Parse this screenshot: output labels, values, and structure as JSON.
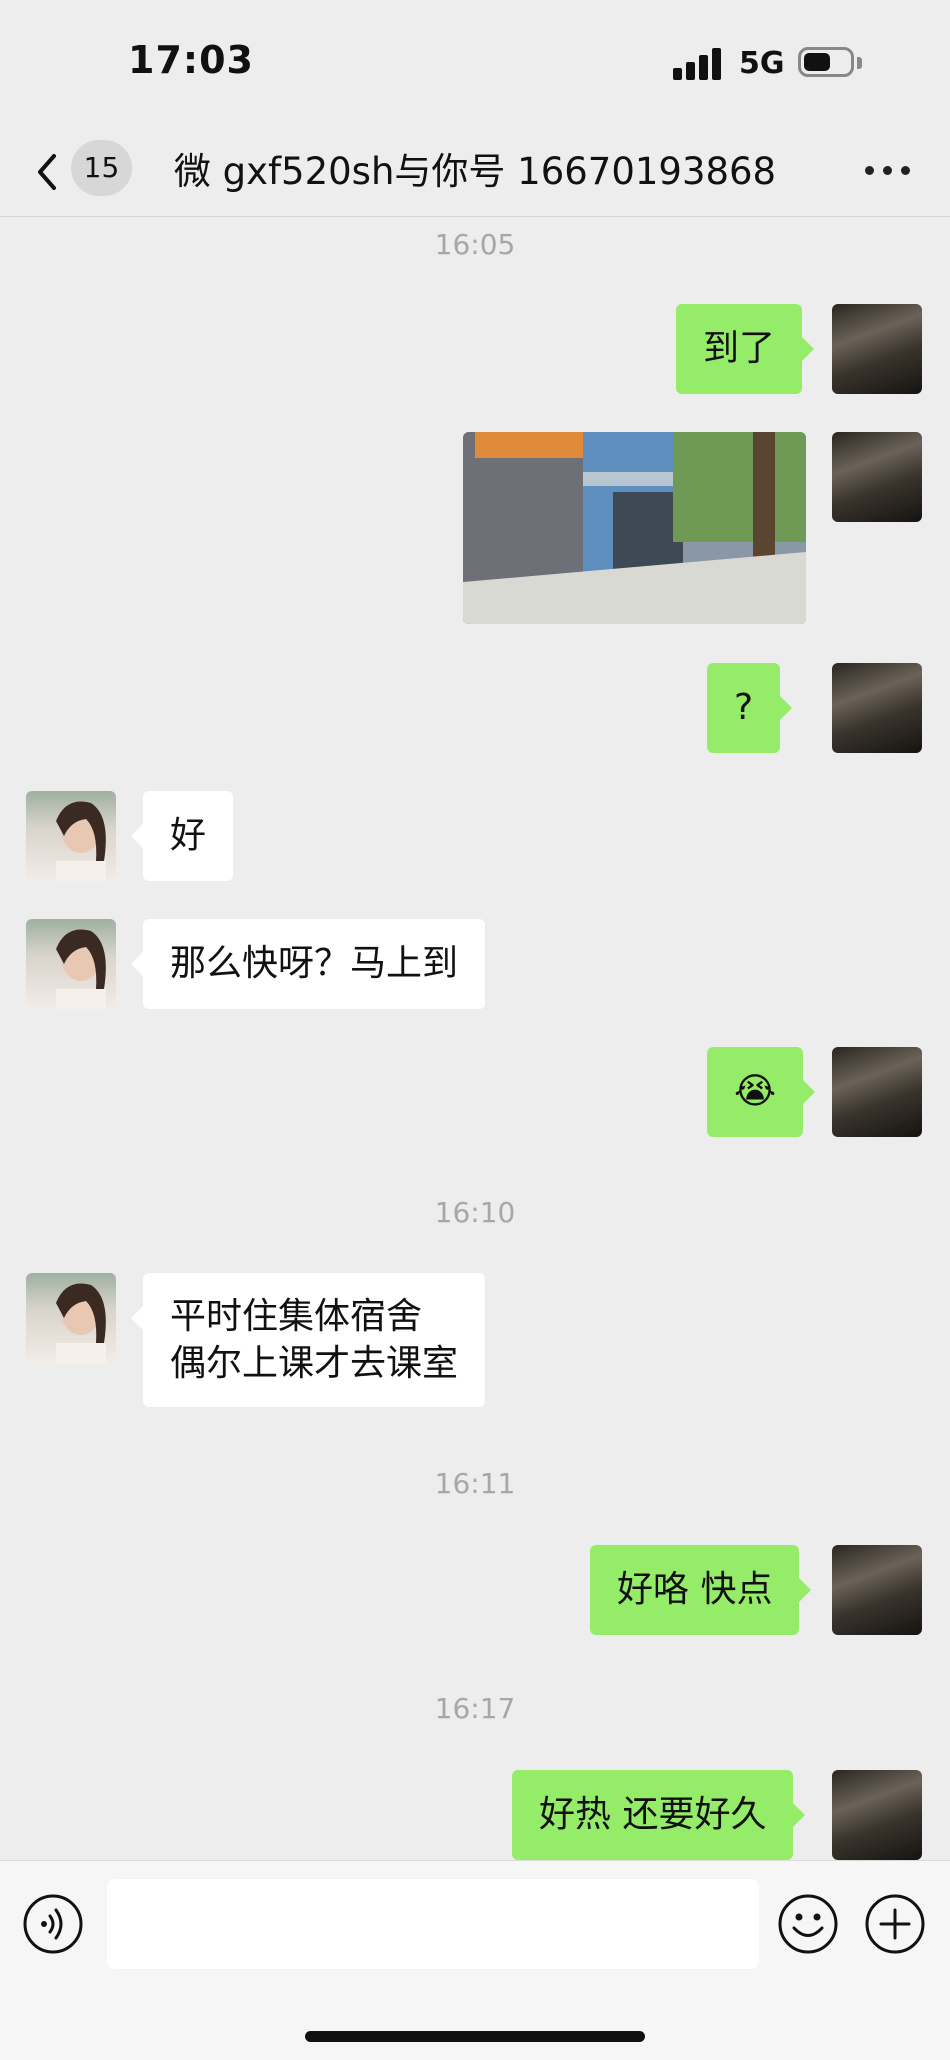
{
  "status_bar": {
    "time": "17:03",
    "network": "5G"
  },
  "nav": {
    "back_badge": "15",
    "title": "微 gxf520sh与你号 16670193868"
  },
  "messages": {
    "t1": "16:05",
    "m1": "到了",
    "m3": "?",
    "m4": "好",
    "m5": "那么快呀？马上到",
    "m6": "😭",
    "t2": "16:10",
    "m7_line1": "平时住集体宿舍",
    "m7_line2": "偶尔上课才去课室",
    "t3": "16:11",
    "m8": "好咯 快点",
    "t4": "16:17",
    "m9": "好热 还要好久"
  },
  "colors": {
    "outgoing_bubble": "#95ec69",
    "incoming_bubble": "#ffffff",
    "background": "#ededed"
  },
  "icons": [
    "back-icon",
    "more-icon",
    "voice-icon",
    "emoji-icon",
    "plus-icon"
  ]
}
